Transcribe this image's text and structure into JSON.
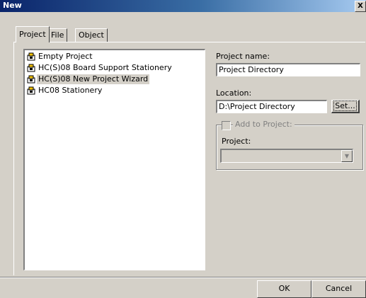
{
  "window": {
    "title": "New",
    "close_glyph": "X"
  },
  "tabs": [
    {
      "label": "Project",
      "active": true
    },
    {
      "label": "File",
      "active": false
    },
    {
      "label": "Object",
      "active": false
    }
  ],
  "project_list": {
    "items": [
      {
        "label": "Empty Project",
        "icon": "project-stationery-icon",
        "selected": false
      },
      {
        "label": "HC(S)08 Board Support Stationery",
        "icon": "project-stationery-icon",
        "selected": false
      },
      {
        "label": "HC(S)08 New Project Wizard",
        "icon": "project-wizard-icon",
        "selected": true
      },
      {
        "label": "HC08 Stationery",
        "icon": "project-stationery-icon",
        "selected": false
      }
    ]
  },
  "project_name": {
    "label": "Project name:",
    "value": "Project Directory"
  },
  "location": {
    "label": "Location:",
    "value": "D:\\Project Directory",
    "set_button": "Set..."
  },
  "add_to_project": {
    "label": "Add to Project:",
    "checked": false,
    "enabled": false,
    "project_label": "Project:",
    "project_value": ""
  },
  "buttons": {
    "ok": "OK",
    "cancel": "Cancel"
  },
  "colors": {
    "titlebar_start": "#0a246a",
    "titlebar_end": "#a6caf0",
    "dialog_face": "#d4d0c8",
    "disabled_text": "#808080"
  }
}
